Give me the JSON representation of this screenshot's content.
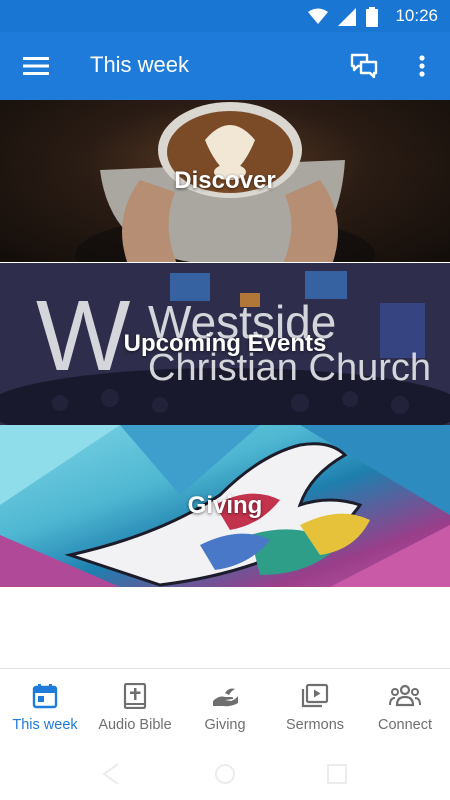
{
  "status_bar": {
    "time": "10:26"
  },
  "app_bar": {
    "title": "This week"
  },
  "tiles": [
    {
      "label": "Discover"
    },
    {
      "label": "Upcoming Events",
      "logo_line1": "Westside",
      "logo_line2": "Christian Church",
      "logo_letter": "W"
    },
    {
      "label": "Giving"
    }
  ],
  "bottom_nav": [
    {
      "label": "This week",
      "icon": "calendar-icon",
      "active": true
    },
    {
      "label": "Audio Bible",
      "icon": "bible-icon",
      "active": false
    },
    {
      "label": "Giving",
      "icon": "giving-hand-icon",
      "active": false
    },
    {
      "label": "Sermons",
      "icon": "sermons-play-icon",
      "active": false
    },
    {
      "label": "Connect",
      "icon": "people-icon",
      "active": false
    }
  ],
  "colors": {
    "primary": "#1e7bd9",
    "status_bar": "#1976d2",
    "inactive": "#6f6f6f"
  }
}
